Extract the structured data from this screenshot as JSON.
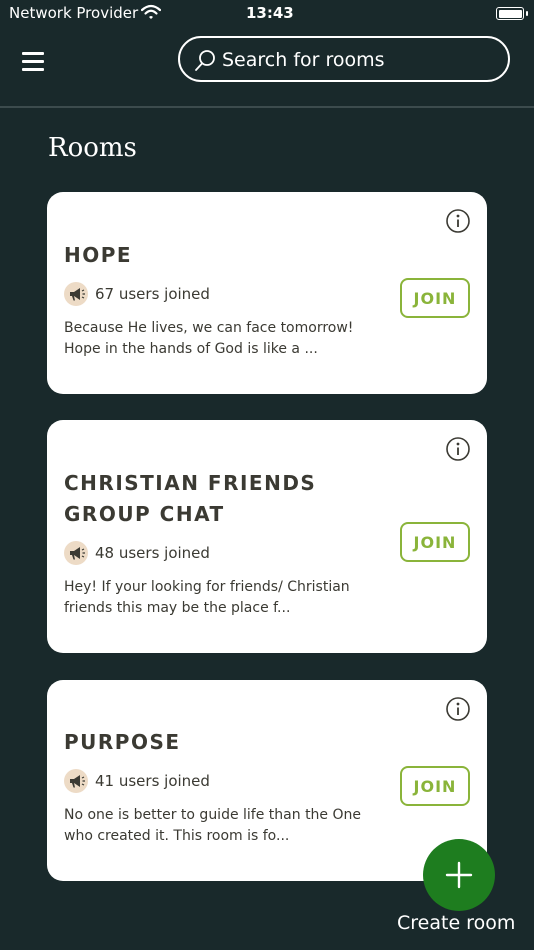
{
  "status_bar": {
    "carrier": "Network Provider",
    "time": "13:43"
  },
  "header": {
    "search": {
      "placeholder": "Search for rooms",
      "value": ""
    }
  },
  "page": {
    "title": "Rooms"
  },
  "rooms": [
    {
      "title": "HOPE",
      "users": "67 users joined",
      "description": "Because He lives, we can face tomorrow! Hope in the hands of God is like a ...",
      "join_label": "JOIN"
    },
    {
      "title": "CHRISTIAN FRIENDS GROUP CHAT",
      "users": "48 users joined",
      "description": "Hey! If your looking for friends/ Christian friends this may be the place f...",
      "join_label": "JOIN"
    },
    {
      "title": "PURPOSE",
      "users": "41 users joined",
      "description": "No one is better to guide life than the One who created it. This room is fo...",
      "join_label": "JOIN"
    }
  ],
  "fab": {
    "label": "Create room"
  },
  "colors": {
    "background": "#19292b",
    "card": "#ffffff",
    "accent_green": "#8ab43a",
    "fab_green": "#1e7d1f",
    "text_dark": "#3b3a33"
  },
  "icons": {
    "menu": "hamburger-menu-icon",
    "search": "search-icon",
    "info": "info-icon",
    "megaphone": "megaphone-icon",
    "add": "plus-icon"
  }
}
